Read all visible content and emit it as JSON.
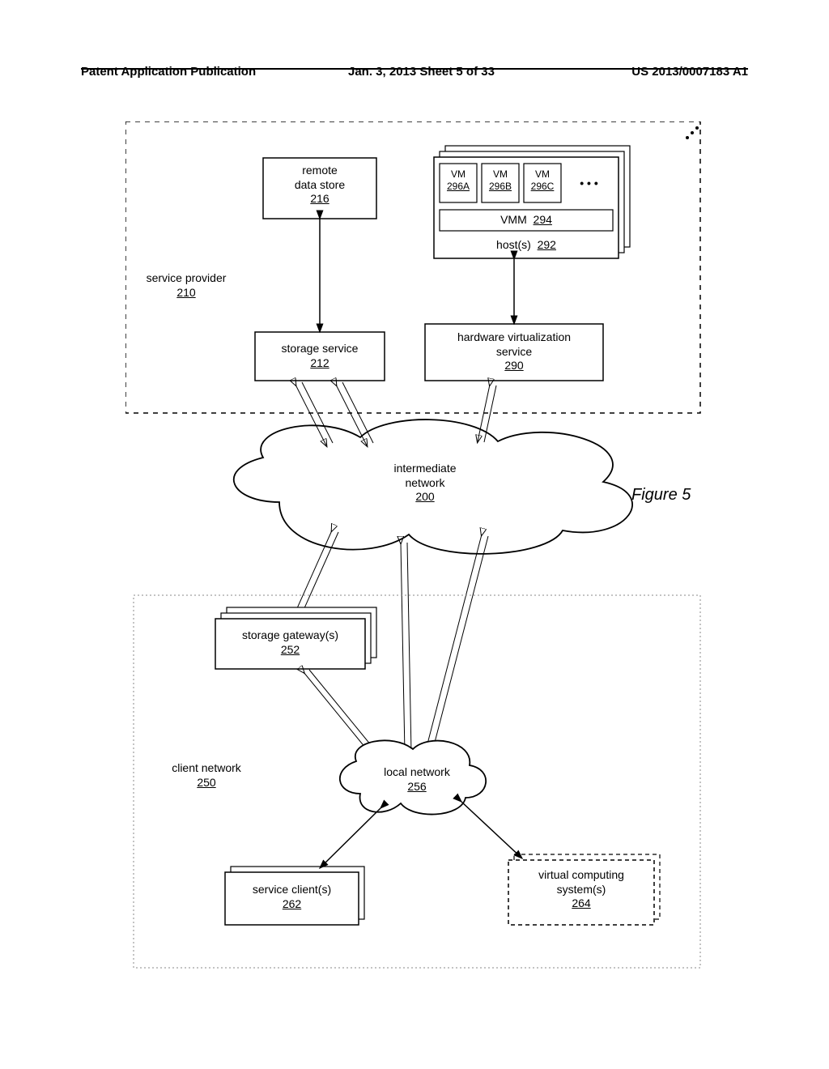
{
  "header": {
    "left": "Patent Application Publication",
    "center": "Jan. 3, 2013  Sheet 5 of 33",
    "right": "US 2013/0007183 A1"
  },
  "figure_label": "Figure 5",
  "boxes": {
    "service_provider": {
      "label": "service provider",
      "ref": "210"
    },
    "remote_data_store": {
      "label": "remote\ndata store",
      "ref": "216"
    },
    "storage_service": {
      "label": "storage service",
      "ref": "212"
    },
    "hardware_virtualization_service": {
      "label": "hardware virtualization\nservice",
      "ref": "290"
    },
    "hosts": {
      "label": "host(s)",
      "ref": "292"
    },
    "vmm": {
      "label": "VMM",
      "ref": "294"
    },
    "vmA": {
      "label": "VM",
      "ref": "296A"
    },
    "vmB": {
      "label": "VM",
      "ref": "296B"
    },
    "vmC": {
      "label": "VM",
      "ref": "296C"
    },
    "ellipsis_vm": "• • •",
    "intermediate_network": {
      "label": "intermediate\nnetwork",
      "ref": "200"
    },
    "client_network": {
      "label": "client network",
      "ref": "250"
    },
    "storage_gateways": {
      "label": "storage gateway(s)",
      "ref": "252"
    },
    "local_network": {
      "label": "local network",
      "ref": "256"
    },
    "service_clients": {
      "label": "service client(s)",
      "ref": "262"
    },
    "virtual_computing_systems": {
      "label": "virtual computing\nsystem(s)",
      "ref": "264"
    }
  }
}
